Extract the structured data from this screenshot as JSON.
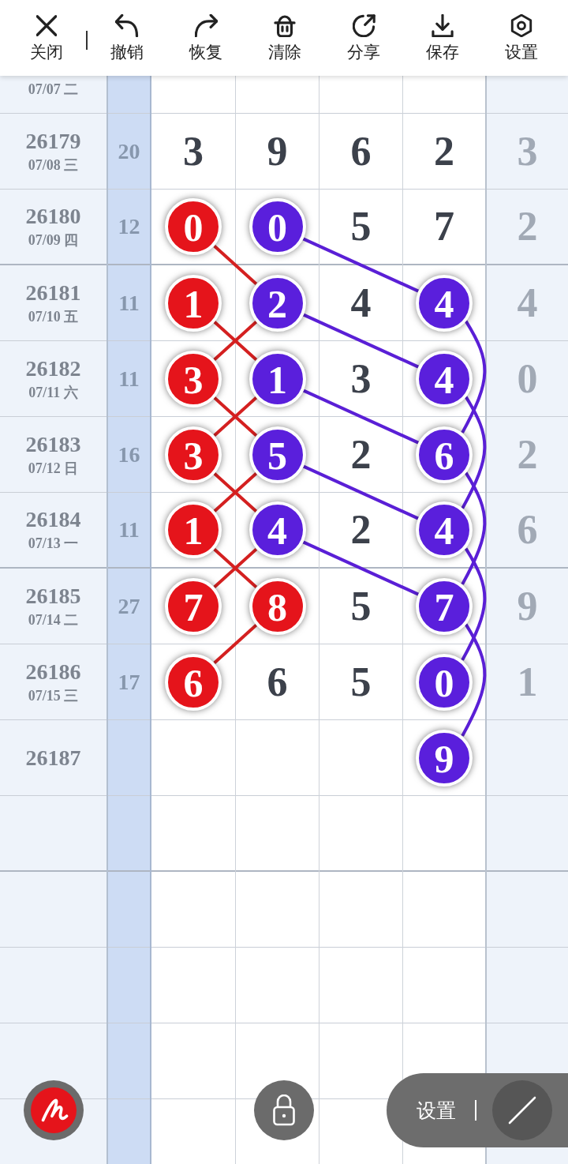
{
  "toolbar": {
    "close": "关闭",
    "actions": [
      "撤销",
      "恢复",
      "清除",
      "分享",
      "保存",
      "设置"
    ]
  },
  "rows": [
    {
      "date": "07/07 二"
    },
    {
      "issue": "26179",
      "date": "07/08 三",
      "sum": "20",
      "cells": [
        {
          "kind": "plain",
          "value": "3"
        },
        {
          "kind": "plain",
          "value": "9"
        },
        {
          "kind": "plain",
          "value": "6"
        },
        {
          "kind": "plain",
          "value": "2"
        }
      ],
      "column_7": "3"
    },
    {
      "issue": "26180",
      "date": "07/09 四",
      "sum": "12",
      "cells": [
        {
          "kind": "ball",
          "value": "0",
          "color": "#e5141b",
          "links": [
            {
              "kind": "next-right",
              "color": "#d42020"
            }
          ]
        },
        {
          "kind": "ball",
          "value": "0",
          "color": "#5a1fdc",
          "links": [
            {
              "kind": "next-right-2",
              "color": "#5a1fd6"
            }
          ]
        },
        {
          "kind": "plain",
          "value": "5"
        },
        {
          "kind": "plain",
          "value": "7"
        }
      ],
      "column_7": "2"
    },
    {
      "issue": "26181",
      "date": "07/10 五",
      "sum": "11",
      "cells": [
        {
          "kind": "ball",
          "value": "1",
          "color": "#e5141b",
          "links": [
            {
              "kind": "next-right",
              "color": "#d42020"
            }
          ]
        },
        {
          "kind": "ball",
          "value": "2",
          "color": "#5a1fdc",
          "links": [
            {
              "kind": "next-left",
              "color": "#d42020"
            },
            {
              "kind": "next-right-2",
              "color": "#5a1fd6"
            }
          ]
        },
        {
          "kind": "plain",
          "value": "4"
        },
        {
          "kind": "ball",
          "value": "4",
          "color": "#5a1fdc",
          "links": [
            {
              "kind": "arc-down-2",
              "color": "#5a1fd6"
            }
          ]
        }
      ],
      "column_7": "4"
    },
    {
      "issue": "26182",
      "date": "07/11 六",
      "sum": "11",
      "cells": [
        {
          "kind": "ball",
          "value": "3",
          "color": "#e5141b",
          "links": [
            {
              "kind": "next-right",
              "color": "#d42020"
            }
          ]
        },
        {
          "kind": "ball",
          "value": "1",
          "color": "#5a1fdc",
          "links": [
            {
              "kind": "next-left",
              "color": "#d42020"
            },
            {
              "kind": "next-right-2",
              "color": "#5a1fd6"
            }
          ]
        },
        {
          "kind": "plain",
          "value": "3"
        },
        {
          "kind": "ball",
          "value": "4",
          "color": "#5a1fdc",
          "links": [
            {
              "kind": "arc-down-2",
              "color": "#5a1fd6"
            }
          ]
        }
      ],
      "column_7": "0"
    },
    {
      "issue": "26183",
      "date": "07/12 日",
      "sum": "16",
      "cells": [
        {
          "kind": "ball",
          "value": "3",
          "color": "#e5141b",
          "links": [
            {
              "kind": "next-right",
              "color": "#d42020"
            }
          ]
        },
        {
          "kind": "ball",
          "value": "5",
          "color": "#5a1fdc",
          "links": [
            {
              "kind": "next-left",
              "color": "#d42020"
            },
            {
              "kind": "next-right-2",
              "color": "#5a1fd6"
            }
          ]
        },
        {
          "kind": "plain",
          "value": "2"
        },
        {
          "kind": "ball",
          "value": "6",
          "color": "#5a1fdc",
          "links": [
            {
              "kind": "arc-down-2",
              "color": "#5a1fd6"
            }
          ]
        }
      ],
      "column_7": "2"
    },
    {
      "issue": "26184",
      "date": "07/13 一",
      "sum": "11",
      "cells": [
        {
          "kind": "ball",
          "value": "1",
          "color": "#e5141b",
          "links": [
            {
              "kind": "next-right",
              "color": "#d42020"
            }
          ]
        },
        {
          "kind": "ball",
          "value": "4",
          "color": "#5a1fdc",
          "links": [
            {
              "kind": "next-left",
              "color": "#d42020"
            },
            {
              "kind": "next-right-2",
              "color": "#5a1fd6"
            }
          ]
        },
        {
          "kind": "plain",
          "value": "2"
        },
        {
          "kind": "ball",
          "value": "4",
          "color": "#5a1fdc",
          "links": [
            {
              "kind": "arc-down-2",
              "color": "#5a1fd6"
            }
          ]
        }
      ],
      "column_7": "6"
    },
    {
      "issue": "26185",
      "date": "07/14 二",
      "sum": "27",
      "cells": [
        {
          "kind": "ball",
          "value": "7",
          "color": "#e5141b"
        },
        {
          "kind": "ball",
          "value": "8",
          "color": "#e5141b",
          "links": [
            {
              "kind": "next-left",
              "color": "#d42020"
            }
          ]
        },
        {
          "kind": "plain",
          "value": "5"
        },
        {
          "kind": "ball",
          "value": "7",
          "color": "#5a1fdc",
          "links": [
            {
              "kind": "arc-down-2",
              "color": "#5a1fd6"
            }
          ]
        }
      ],
      "column_7": "9"
    },
    {
      "issue": "26186",
      "date": "07/15 三",
      "sum": "17",
      "cells": [
        {
          "kind": "ball",
          "value": "6",
          "color": "#e5141b"
        },
        {
          "kind": "plain",
          "value": "6"
        },
        {
          "kind": "plain",
          "value": "5"
        },
        {
          "kind": "ball",
          "value": "0",
          "color": "#5a1fdc"
        }
      ],
      "column_7": "1"
    },
    {
      "issue": "26187",
      "cells": [
        {
          "kind": "empty"
        },
        {
          "kind": "empty"
        },
        {
          "kind": "empty"
        },
        {
          "kind": "ball",
          "value": "9",
          "color": "#5a1fdc"
        }
      ]
    }
  ],
  "bottom_panel": {
    "settings_label": "设置"
  }
}
